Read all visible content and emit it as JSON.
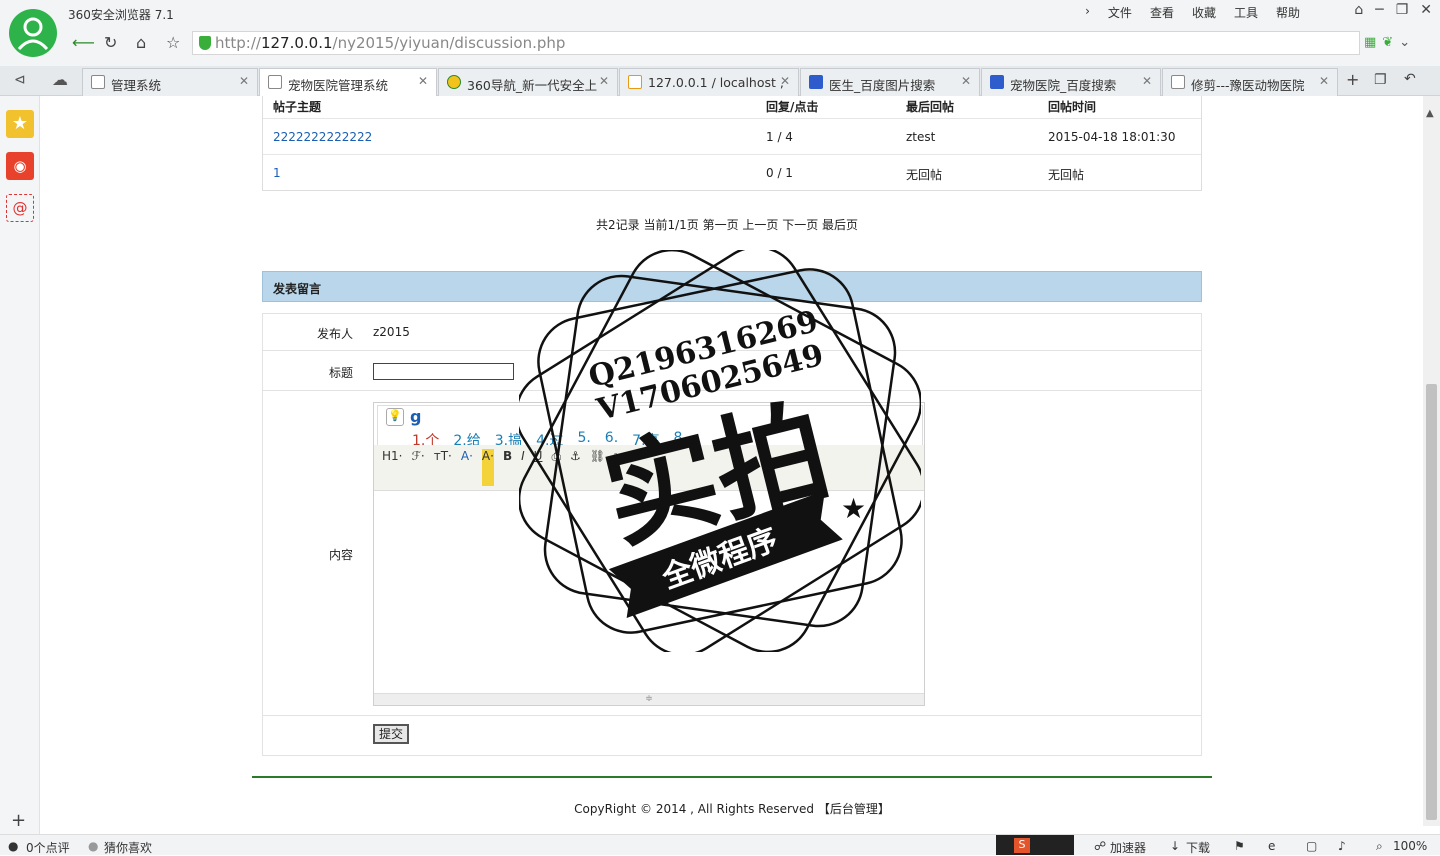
{
  "window": {
    "title": "360安全浏览器 7.1",
    "menu": [
      "文件",
      "查看",
      "收藏",
      "工具",
      "帮助"
    ]
  },
  "address": {
    "prefix": "http://",
    "host": "127.0.0.1",
    "path": "/ny2015/yiyuan/discussion.php"
  },
  "tabs": [
    {
      "label": "管理系统",
      "active": false
    },
    {
      "label": "宠物医院管理系统",
      "active": true
    },
    {
      "label": "360导航_新一代安全上",
      "active": false
    },
    {
      "label": "127.0.0.1 / localhost ,",
      "active": false
    },
    {
      "label": "医生_百度图片搜索",
      "active": false
    },
    {
      "label": "宠物医院_百度搜索",
      "active": false
    },
    {
      "label": "修剪---豫医动物医院",
      "active": false
    }
  ],
  "table": {
    "headers": [
      "帖子主题",
      "回复/点击",
      "最后回帖",
      "回帖时间"
    ],
    "rows": [
      {
        "topic": "2222222222222",
        "replies": "1 / 4",
        "last": "ztest",
        "time": "2015-04-18 18:01:30"
      },
      {
        "topic": "1",
        "replies": "0 / 1",
        "last": "无回帖",
        "time": "无回帖"
      }
    ]
  },
  "pager": {
    "text": "共2记录  当前1/1页    第一页 上一页 下一页 最后页"
  },
  "form": {
    "section_title": "发表留言",
    "poster_label": "发布人",
    "poster_value": "z2015",
    "title_label": "标题",
    "content_label": "内容",
    "submit_label": "提交",
    "ime": {
      "pinyin": "g",
      "candidates": [
        "1.个",
        "2.给",
        "3.搞",
        "4.过",
        "5.",
        "6.",
        "7.高",
        "8."
      ]
    },
    "toolbar": [
      "H1·",
      "ℱ·",
      "тT·",
      "A·",
      "A·",
      "B",
      "I",
      "U"
    ]
  },
  "stamp": {
    "line1": "Q2196316269",
    "line2": "V1706025649",
    "big": "实拍",
    "banner": "全微程序"
  },
  "footer": {
    "text": "CopyRight © 2014 , All Rights Reserved 【后台管理】"
  },
  "status": {
    "comments": "0个点评",
    "likes": "猜你喜欢",
    "accel": "加速器",
    "download": "下载",
    "zoom": "100%"
  }
}
